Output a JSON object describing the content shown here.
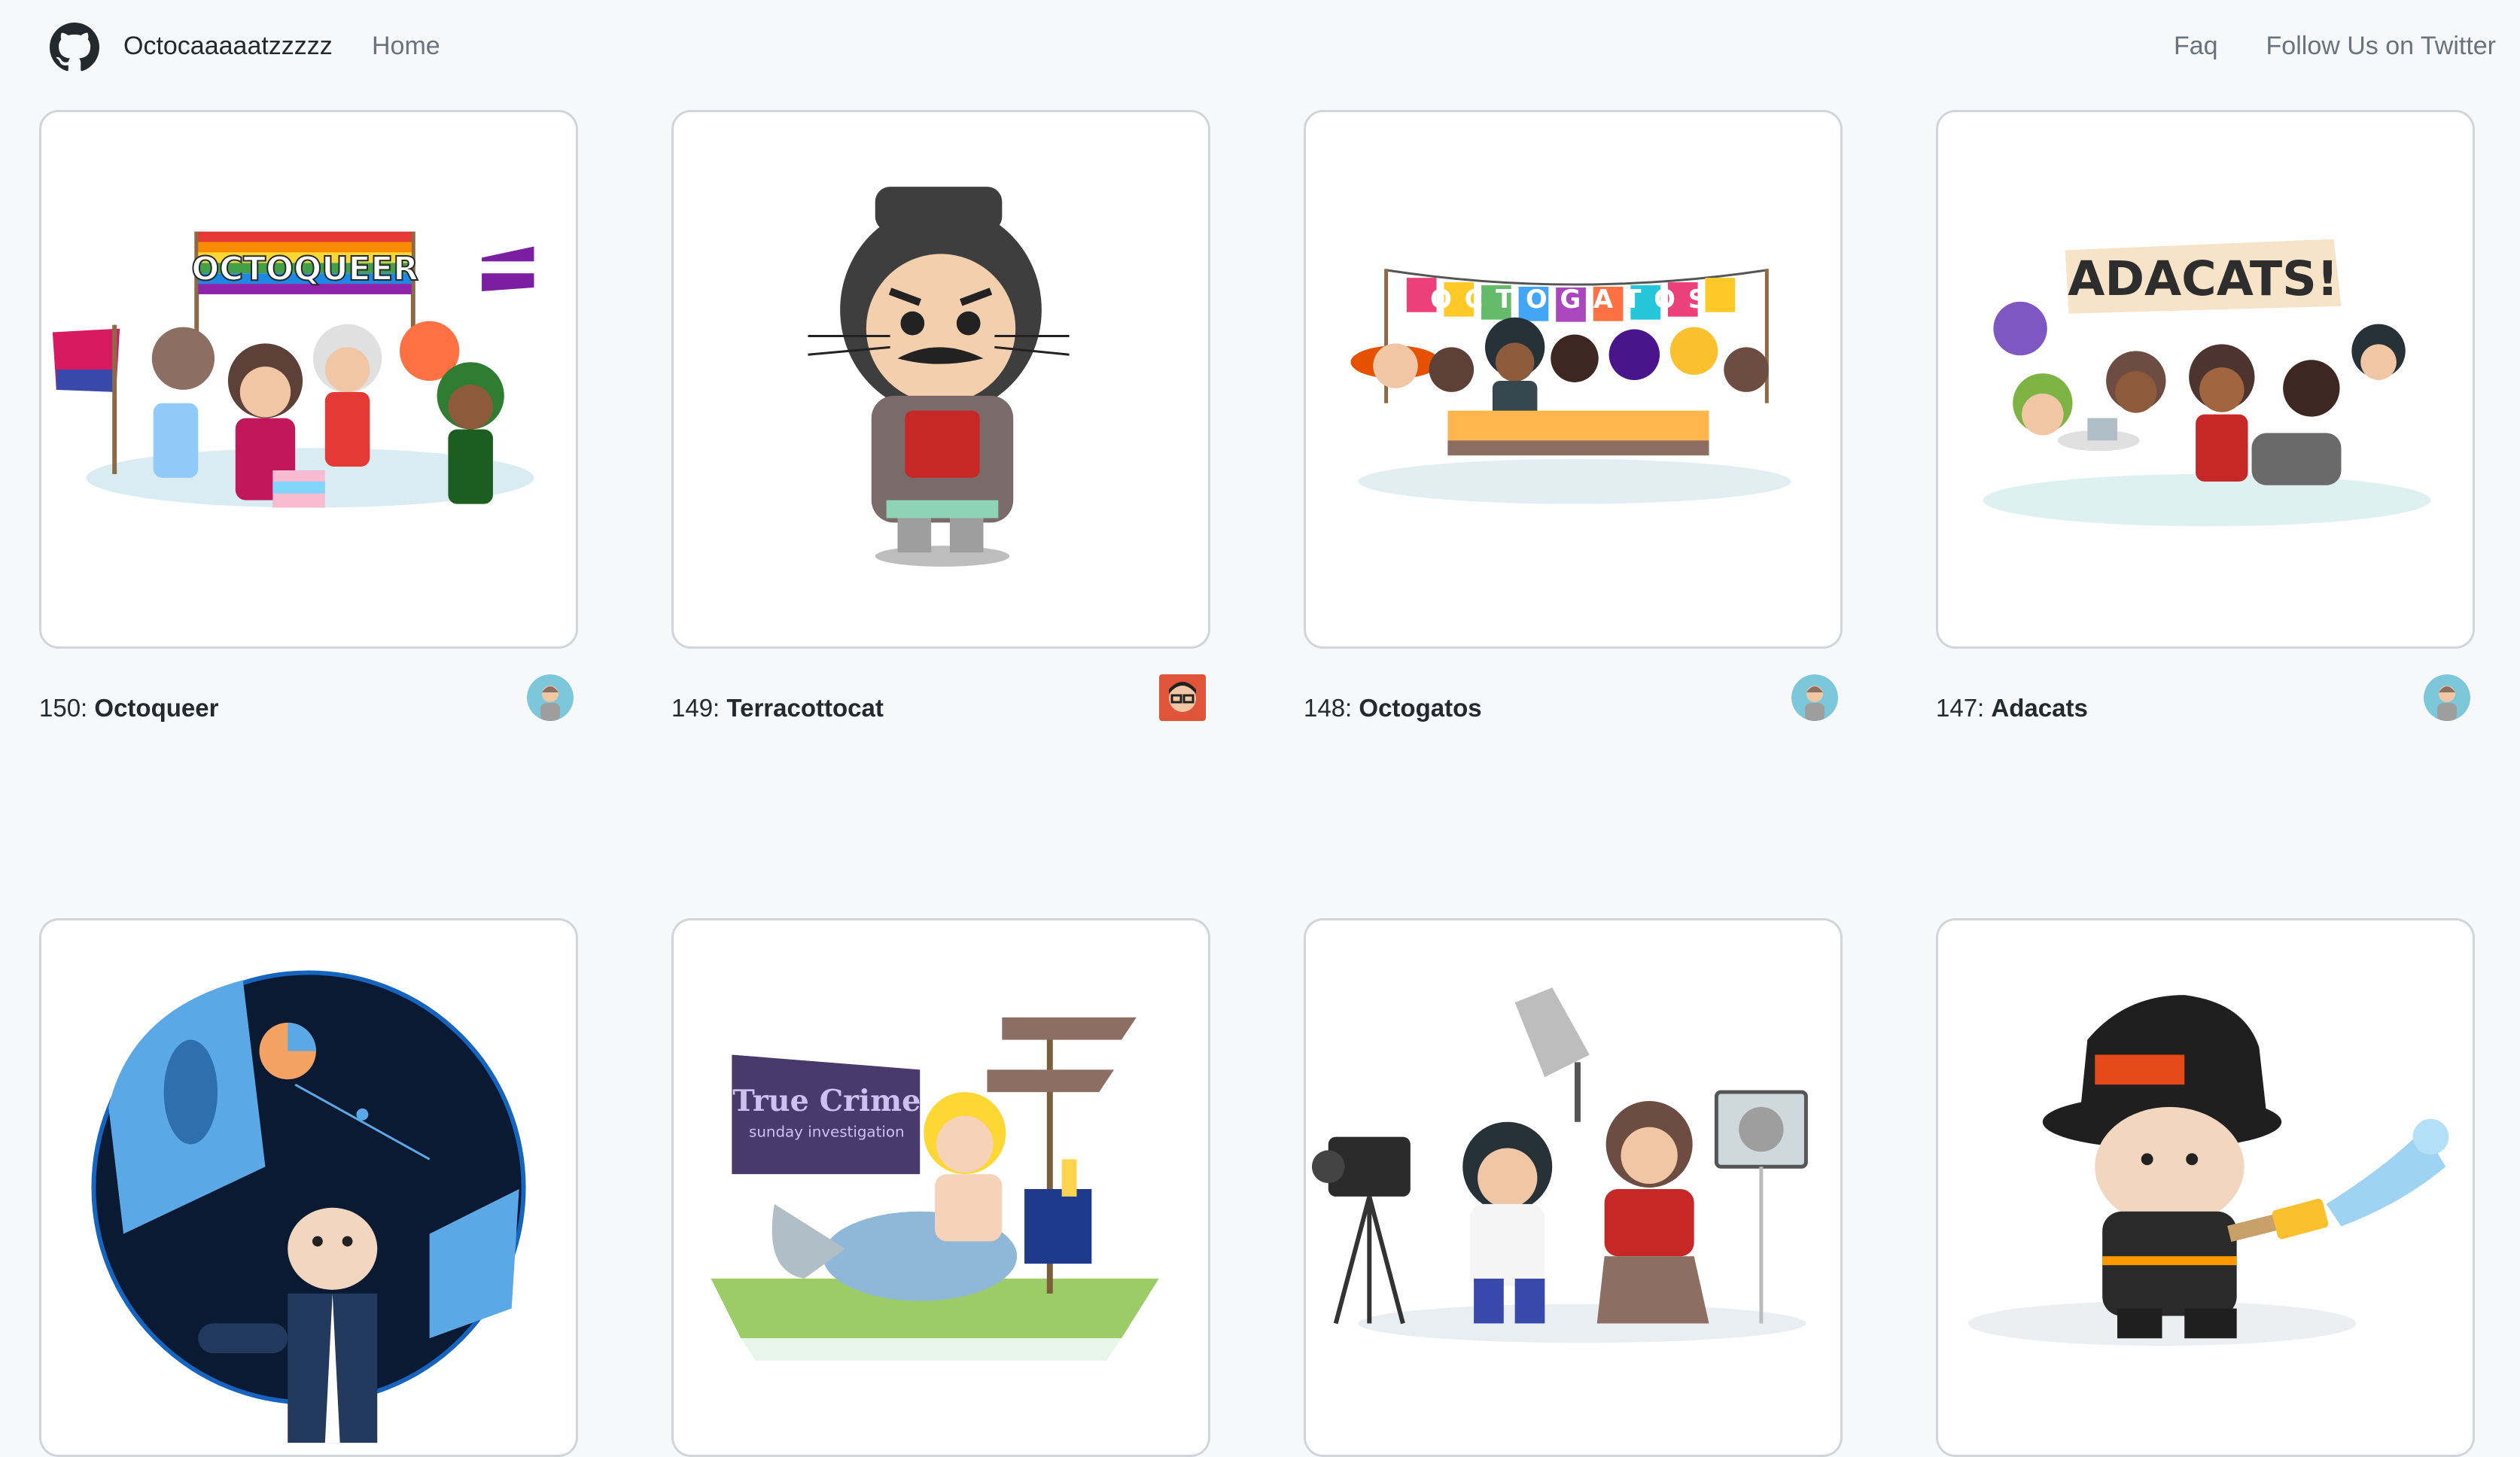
{
  "nav": {
    "brand": "Octocaaaaatzzzzz",
    "home": "Home",
    "faq": "Faq",
    "twitter": "Follow Us on Twitter",
    "logo_icon": "github-octocat-icon"
  },
  "cards": [
    {
      "number": "150:",
      "name": "Octoqueer",
      "banner": "OCTOQUEER"
    },
    {
      "number": "149:",
      "name": "Terracottocat"
    },
    {
      "number": "148:",
      "name": "Octogatos",
      "banner": "OCTOGATOS"
    },
    {
      "number": "147:",
      "name": "Adacats",
      "banner": "ADACATS!"
    },
    {
      "number": "",
      "name": ""
    },
    {
      "number": "",
      "name": "",
      "sign_title": "True Crime",
      "sign_sub": "sunday investigation"
    },
    {
      "number": "",
      "name": ""
    },
    {
      "number": "",
      "name": ""
    }
  ],
  "colors": {
    "background": "#f6f8fa",
    "card_border": "#d1d5da",
    "nav_link": "#6a737d",
    "text": "#24292e"
  }
}
